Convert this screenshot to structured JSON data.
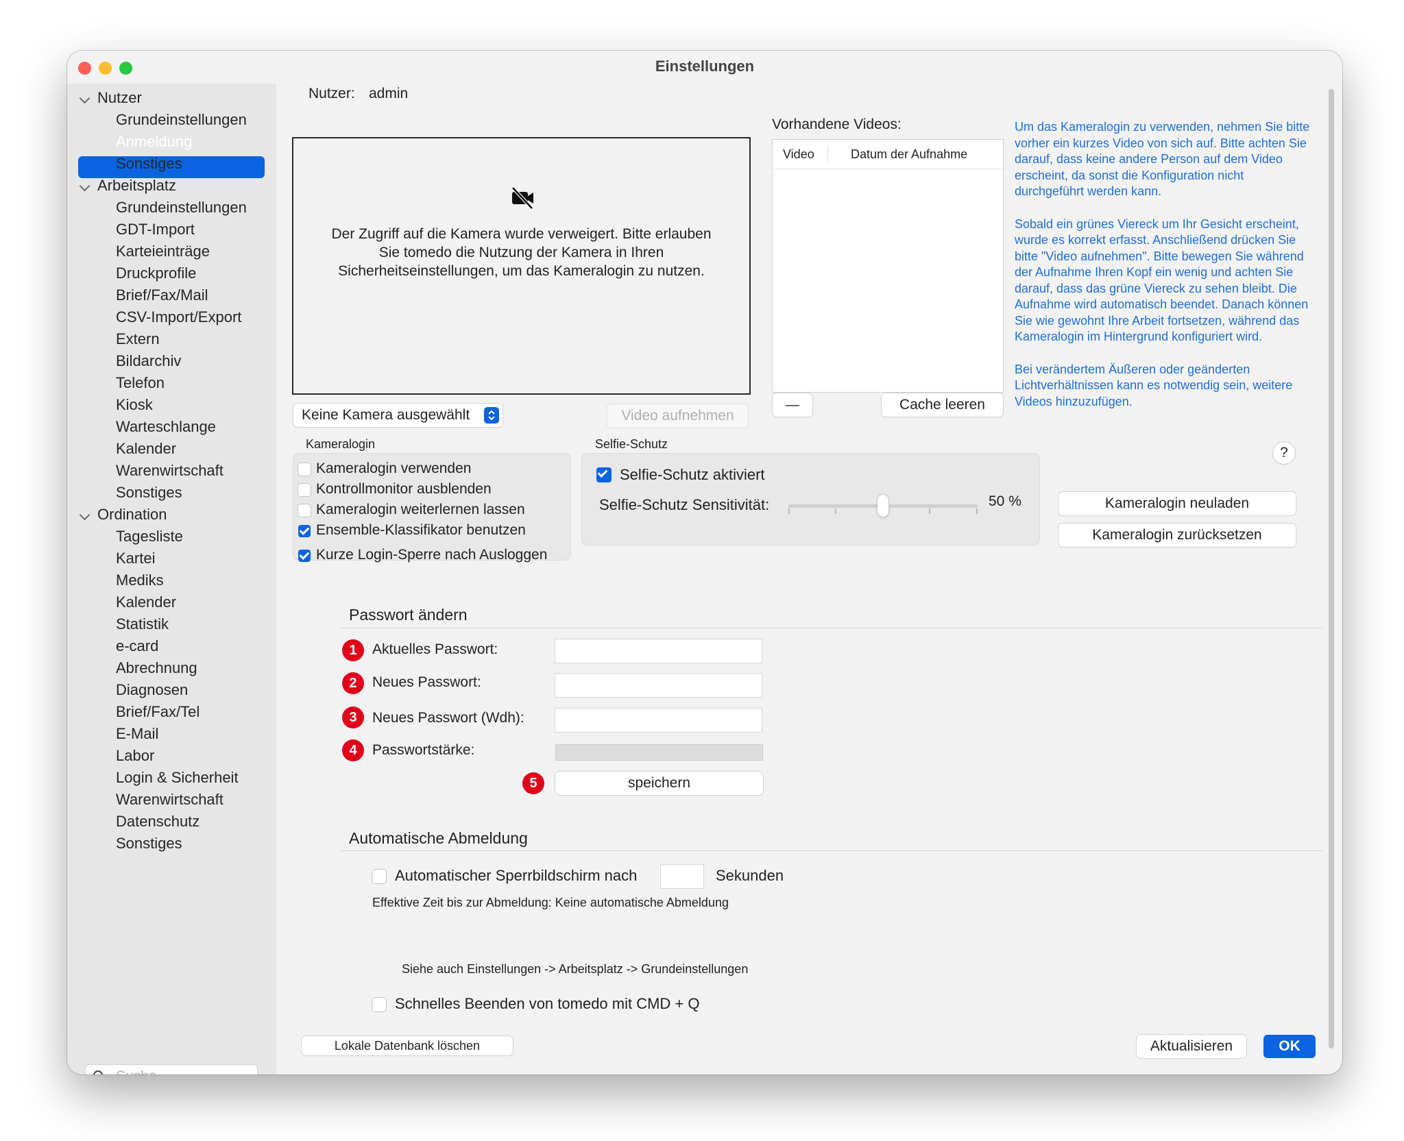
{
  "window": {
    "title": "Einstellungen"
  },
  "sidebar": {
    "groups": [
      {
        "label": "Nutzer",
        "items": [
          "Grundeinstellungen",
          "Anmeldung",
          "Sonstiges"
        ]
      },
      {
        "label": "Arbeitsplatz",
        "items": [
          "Grundeinstellungen",
          "GDT-Import",
          "Karteieinträge",
          "Druckprofile",
          "Brief/Fax/Mail",
          "CSV-Import/Export",
          "Extern",
          "Bildarchiv",
          "Telefon",
          "Kiosk",
          "Warteschlange",
          "Kalender",
          "Warenwirtschaft",
          "Sonstiges"
        ]
      },
      {
        "label": "Ordination",
        "items": [
          "Tagesliste",
          "Kartei",
          "Mediks",
          "Kalender",
          "Statistik",
          "e-card",
          "Abrechnung",
          "Diagnosen",
          "Brief/Fax/Tel",
          "E-Mail",
          "Labor",
          "Login & Sicherheit",
          "Warenwirtschaft",
          "Datenschutz",
          "Sonstiges"
        ]
      }
    ],
    "selected": "Anmeldung",
    "search_placeholder": "Suche"
  },
  "user": {
    "label": "Nutzer:",
    "value": "admin"
  },
  "camera": {
    "message": "Der Zugriff auf die Kamera wurde verweigert. Bitte erlauben Sie tomedo die Nutzung der Kamera in Ihren Sicherheitseinstellungen, um das Kameralogin zu nutzen.",
    "select_value": "Keine Kamera ausgewählt",
    "record_button": "Video aufnehmen"
  },
  "videos": {
    "title": "Vorhandene Videos:",
    "columns": [
      "Video",
      "Datum der Aufnahme"
    ],
    "remove_button": "—",
    "clear_button": "Cache leeren"
  },
  "info": {
    "paragraphs": [
      "Um das Kameralogin zu verwenden, nehmen Sie bitte vorher ein kurzes Video von sich auf. Bitte achten Sie darauf, dass keine andere Person auf dem Video erscheint, da sonst die Konfiguration nicht durchgeführt werden kann.",
      "Sobald ein grünes Viereck um Ihr Gesicht erscheint, wurde es korrekt erfasst. Anschließend drücken Sie bitte \"Video aufnehmen\". Bitte bewegen Sie während der Aufnahme Ihren Kopf ein wenig und achten Sie darauf, dass das grüne Viereck zu sehen bleibt. Die Aufnahme wird automatisch beendet. Danach können Sie wie gewohnt Ihre Arbeit fortsetzen, während das Kameralogin im Hintergrund konfiguriert wird.",
      "Bei verändertem Äußeren oder geänderten Lichtverhältnissen kann es notwendig sein, weitere Videos hinzuzufügen."
    ],
    "help": "?"
  },
  "kameralogin": {
    "title": "Kameralogin",
    "options": [
      {
        "label": "Kameralogin verwenden",
        "checked": false
      },
      {
        "label": "Kontrollmonitor ausblenden",
        "checked": false
      },
      {
        "label": "Kameralogin weiterlernen lassen",
        "checked": false
      },
      {
        "label": "Ensemble-Klassifikator benutzen",
        "checked": true
      },
      {
        "label": "Kurze Login-Sperre nach Ausloggen",
        "checked": true
      }
    ]
  },
  "selfie": {
    "title": "Selfie-Schutz",
    "enabled_label": "Selfie-Schutz aktiviert",
    "enabled": true,
    "sensitivity_label": "Selfie-Schutz Sensitivität:",
    "sensitivity_value": 50,
    "sensitivity_text": "50 %"
  },
  "actions": {
    "reload": "Kameralogin neuladen",
    "reset": "Kameralogin zurücksetzen"
  },
  "password": {
    "title": "Passwort ändern",
    "fields": [
      {
        "badge": "1",
        "label": "Aktuelles Passwort:"
      },
      {
        "badge": "2",
        "label": "Neues Passwort:"
      },
      {
        "badge": "3",
        "label": "Neues Passwort (Wdh):"
      },
      {
        "badge": "4",
        "label": "Passwortstärke:"
      }
    ],
    "save_badge": "5",
    "save_button": "speichern"
  },
  "autologout": {
    "title": "Automatische Abmeldung",
    "checkbox_label": "Automatischer Sperrbildschirm nach",
    "seconds_label": "Sekunden",
    "effective_text": "Effektive Zeit bis zur Abmeldung: Keine automatische Abmeldung",
    "see_also": "Siehe auch Einstellungen -> Arbeitsplatz -> Grundeinstellungen",
    "quick_quit_label": "Schnelles Beenden von tomedo mit CMD + Q"
  },
  "footer": {
    "delete_db": "Lokale Datenbank löschen",
    "refresh": "Aktualisieren",
    "ok": "OK"
  },
  "colors": {
    "accent": "#0a64e1",
    "info_text": "#1e6fd8",
    "badge": "#e0001a"
  }
}
